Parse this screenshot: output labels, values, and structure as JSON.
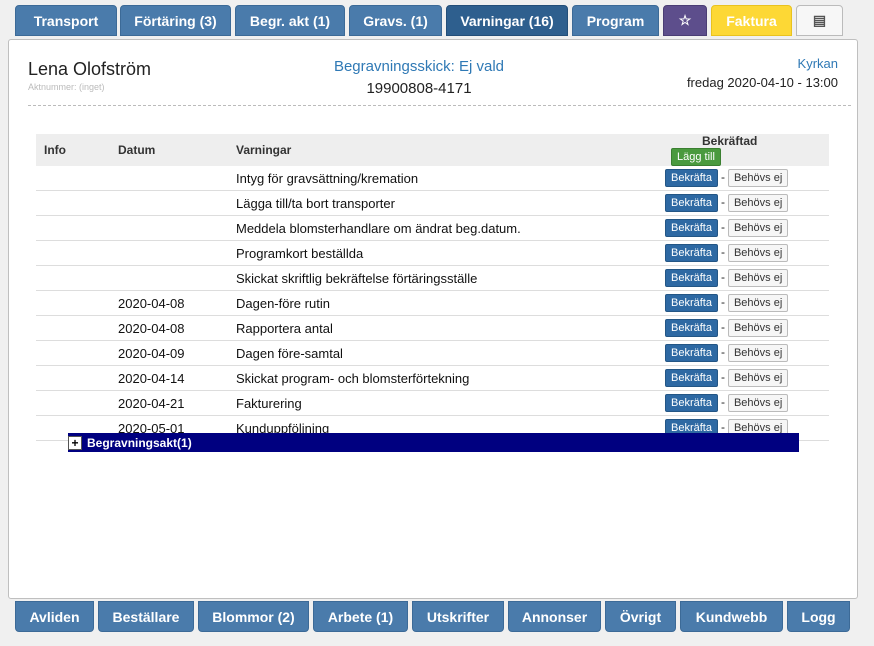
{
  "top_tabs": [
    {
      "label": "Transport"
    },
    {
      "label": "Förtäring (3)"
    },
    {
      "label": "Begr. akt (1)"
    },
    {
      "label": "Gravs. (1)"
    },
    {
      "label": "Varningar (16)"
    },
    {
      "label": "Program"
    },
    {
      "label": "☆",
      "icon": "star-icon"
    },
    {
      "label": "Faktura"
    },
    {
      "label": "▤",
      "icon": "list-icon"
    }
  ],
  "header": {
    "name": "Lena Olofström",
    "account_number": "Aktnummer: (inget)",
    "burial_method": "Begravningsskick: Ej vald",
    "personal_number": "19900808-4171",
    "location": "Kyrkan",
    "datetime": "fredag 2020-04-10 - 13:00"
  },
  "table": {
    "headers": {
      "info": "Info",
      "date": "Datum",
      "warning": "Varningar",
      "confirmed": "Bekräftad"
    },
    "add_label": "Lägg till",
    "confirm_label": "Bekräfta",
    "not_needed_label": "Behövs ej",
    "separator": "-",
    "rows": [
      {
        "date": "",
        "warning": "Intyg för gravsättning/kremation"
      },
      {
        "date": "",
        "warning": "Lägga till/ta bort transporter"
      },
      {
        "date": "",
        "warning": "Meddela blomsterhandlare om ändrat beg.datum."
      },
      {
        "date": "",
        "warning": "Programkort beställda"
      },
      {
        "date": "",
        "warning": "Skickat skriftlig bekräftelse förtäringsställe"
      },
      {
        "date": "2020-04-08",
        "warning": "Dagen-före rutin"
      },
      {
        "date": "2020-04-08",
        "warning": "Rapportera antal"
      },
      {
        "date": "2020-04-09",
        "warning": "Dagen före-samtal"
      },
      {
        "date": "2020-04-14",
        "warning": "Skickat program- och blomsterförtekning"
      },
      {
        "date": "2020-04-21",
        "warning": "Fakturering"
      },
      {
        "date": "2020-05-01",
        "warning": "Kunduppföljning"
      }
    ]
  },
  "act_section": {
    "expand_symbol": "+",
    "label": "Begravningsakt(1)"
  },
  "bottom_tabs": [
    {
      "label": "Avliden"
    },
    {
      "label": "Beställare"
    },
    {
      "label": "Blommor (2)"
    },
    {
      "label": "Arbete (1)"
    },
    {
      "label": "Utskrifter"
    },
    {
      "label": "Annonser"
    },
    {
      "label": "Övrigt"
    },
    {
      "label": "Kundwebb"
    },
    {
      "label": "Logg"
    }
  ]
}
